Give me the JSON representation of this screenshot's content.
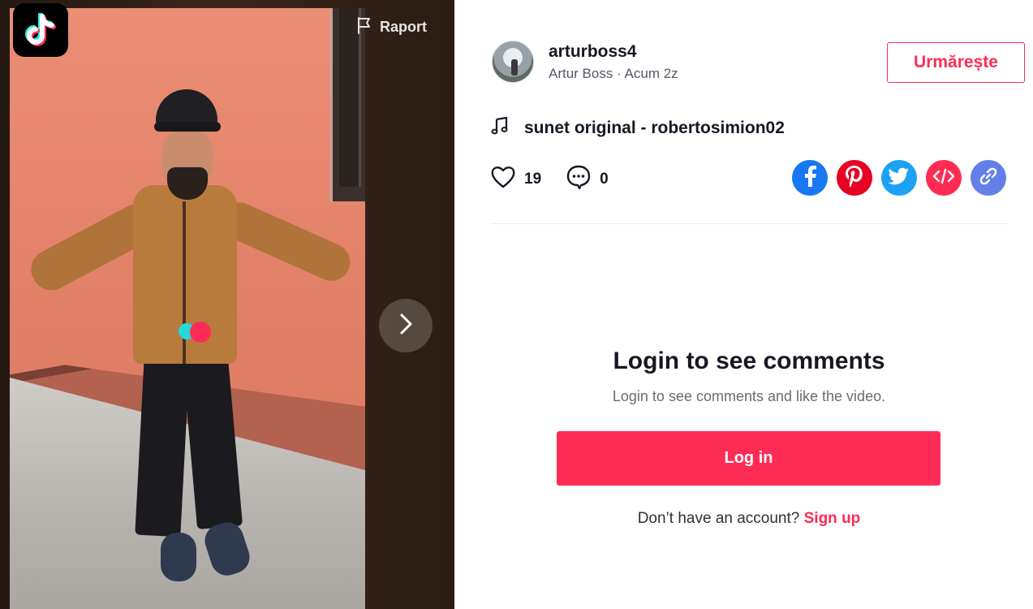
{
  "player": {
    "report_label": "Raport",
    "icons": {
      "logo": "tiktok-logo-icon",
      "report": "flag-icon",
      "next": "chevron-right-icon"
    }
  },
  "author": {
    "username": "arturboss4",
    "display_name": "Artur Boss",
    "separator": " · ",
    "posted": "Acum 2z",
    "follow_label": "Urmărește"
  },
  "music": {
    "icon": "music-note-icon",
    "label": "sunet original - robertosimion02"
  },
  "stats": {
    "likes": "19",
    "comments": "0"
  },
  "share": [
    {
      "name": "facebook",
      "icon": "facebook-icon",
      "color": "#1877f2"
    },
    {
      "name": "pinterest",
      "icon": "pinterest-icon",
      "color": "#e60023"
    },
    {
      "name": "twitter",
      "icon": "twitter-icon",
      "color": "#1da1f2"
    },
    {
      "name": "embed",
      "icon": "embed-code-icon",
      "color": "#fe2c55"
    },
    {
      "name": "copy-link",
      "icon": "link-icon",
      "color": "#6480e8"
    }
  ],
  "comments": {
    "title": "Login to see comments",
    "subtitle": "Login to see comments and like the video.",
    "login_label": "Log in",
    "signup_prompt": "Don’t have an account?",
    "signup_label": "Sign up"
  },
  "colors": {
    "accent": "#fe2c55",
    "text": "#161823",
    "muted": "#6a6c74"
  }
}
